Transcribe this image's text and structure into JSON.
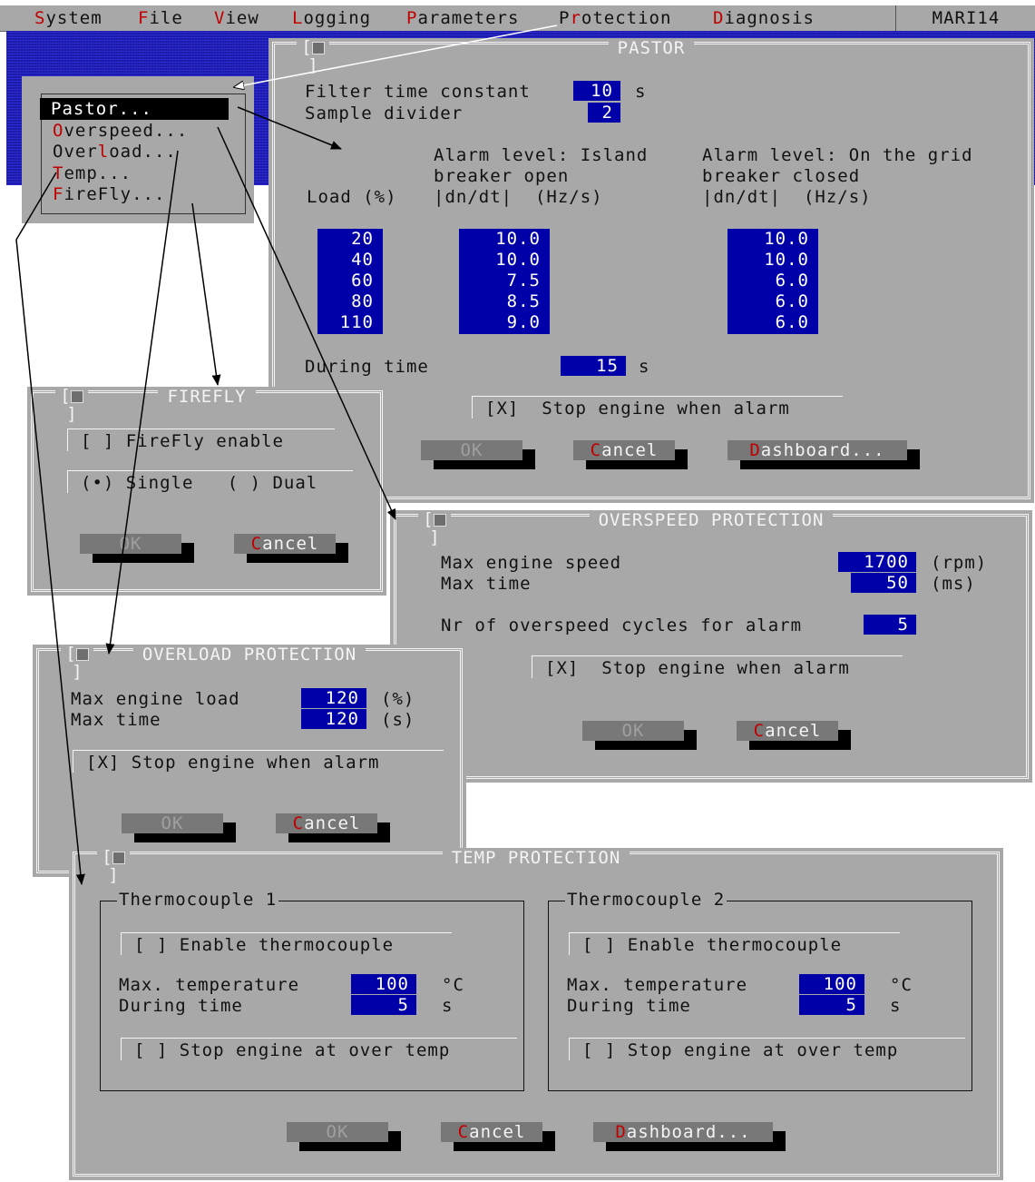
{
  "menubar": {
    "items": [
      {
        "hotkey": "S",
        "rest": "ystem"
      },
      {
        "hotkey": "F",
        "rest": "ile"
      },
      {
        "hotkey": "V",
        "rest": "iew"
      },
      {
        "hotkey": "L",
        "rest": "ogging"
      },
      {
        "hotkey": "P",
        "rest": "arameters"
      },
      {
        "pre": "P",
        "hotkey": "r",
        "rest": "otection"
      },
      {
        "hotkey": "D",
        "rest": "iagnosis"
      }
    ],
    "station": "MARI14"
  },
  "submenu": {
    "items": [
      {
        "pre": "",
        "hotkey": "P",
        "rest": "astor..."
      },
      {
        "pre": "",
        "hotkey": "O",
        "rest": "verspeed..."
      },
      {
        "pre": "Over",
        "hotkey": "l",
        "rest": "oad..."
      },
      {
        "pre": "",
        "hotkey": "T",
        "rest": "emp..."
      },
      {
        "pre": "",
        "hotkey": "F",
        "rest": "ireFly..."
      }
    ]
  },
  "pastor": {
    "title": "PASTOR",
    "filter_label": "Filter time constant",
    "filter_value": "10",
    "filter_unit": "s",
    "divider_label": "Sample divider",
    "divider_value": "2",
    "island_header_1": "Alarm level: Island",
    "island_header_2": "breaker open",
    "island_header_3": "|dn/dt|  (Hz/s)",
    "grid_header_1": "Alarm level: On the grid",
    "grid_header_2": "breaker closed",
    "grid_header_3": "|dn/dt|  (Hz/s)",
    "load_header": "Load (%)",
    "loads": [
      "20",
      "40",
      "60",
      "80",
      "110"
    ],
    "island_values": [
      "10.0",
      "10.0",
      "7.5",
      "8.5",
      "9.0"
    ],
    "grid_values": [
      "10.0",
      "10.0",
      "6.0",
      "6.0",
      "6.0"
    ],
    "during_label": "During time",
    "during_value": "15",
    "during_unit": "s",
    "stop_checkbox": "[X]  Stop engine when alarm",
    "ok_hk": "O",
    "ok_rest": "K",
    "cancel_hk": "C",
    "cancel_rest": "ancel",
    "dash_hk": "D",
    "dash_rest": "ashboard..."
  },
  "firefly": {
    "title": "FIREFLY",
    "enable_checkbox": "[ ] FireFly enable",
    "mode_radio": "(•) Single   ( ) Dual",
    "ok_hk": "O",
    "ok_rest": "K",
    "cancel_hk": "C",
    "cancel_rest": "ancel"
  },
  "overspeed": {
    "title": "OVERSPEED PROTECTION",
    "speed_label": "Max engine speed",
    "speed_value": "1700",
    "speed_unit": "(rpm)",
    "time_label": "Max time",
    "time_value": "50",
    "time_unit": "(ms)",
    "cycles_label": "Nr of overspeed cycles for alarm",
    "cycles_value": "5",
    "stop_checkbox": "[X]  Stop engine when alarm",
    "ok_hk": "O",
    "ok_rest": "K",
    "cancel_hk": "C",
    "cancel_rest": "ancel"
  },
  "overload": {
    "title": "OVERLOAD PROTECTION",
    "load_label": "Max engine load",
    "load_value": "120",
    "load_unit": "(%)",
    "time_label": "Max time",
    "time_value": "120",
    "time_unit": "(s)",
    "stop_checkbox": "[X] Stop engine when alarm",
    "ok_hk": "O",
    "ok_rest": "K",
    "cancel_hk": "C",
    "cancel_rest": "ancel"
  },
  "temp": {
    "title": "TEMP PROTECTION",
    "tc1": {
      "group": "Thermocouple 1",
      "enable_checkbox": "[ ] Enable thermocouple",
      "max_label": "Max. temperature",
      "max_value": "100",
      "max_unit": "°C",
      "during_label": "During time",
      "during_value": "5",
      "during_unit": "s",
      "stop_checkbox": "[ ] Stop engine at over temp"
    },
    "tc2": {
      "group": "Thermocouple 2",
      "enable_checkbox": "[ ] Enable thermocouple",
      "max_label": "Max. temperature",
      "max_value": "100",
      "max_unit": "°C",
      "during_label": "During time",
      "during_value": "5",
      "during_unit": "s",
      "stop_checkbox": "[ ] Stop engine at over temp"
    },
    "ok_hk": "O",
    "ok_rest": "K",
    "cancel_hk": "C",
    "cancel_rest": "ancel",
    "dash_hk": "D",
    "dash_rest": "ashboard..."
  }
}
